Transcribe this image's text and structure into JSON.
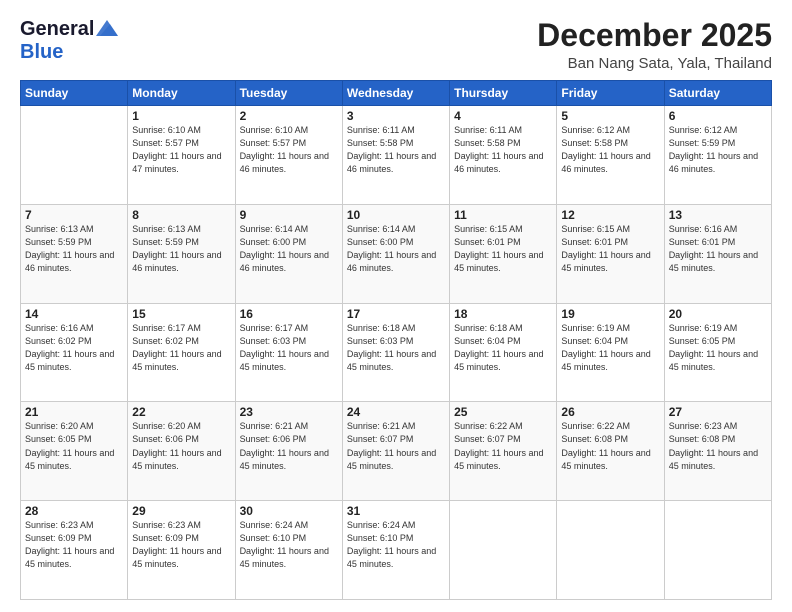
{
  "logo": {
    "general": "General",
    "blue": "Blue"
  },
  "header": {
    "month_title": "December 2025",
    "location": "Ban Nang Sata, Yala, Thailand"
  },
  "days_of_week": [
    "Sunday",
    "Monday",
    "Tuesday",
    "Wednesday",
    "Thursday",
    "Friday",
    "Saturday"
  ],
  "weeks": [
    [
      {
        "day": "",
        "info": ""
      },
      {
        "day": "1",
        "info": "Sunrise: 6:10 AM\nSunset: 5:57 PM\nDaylight: 11 hours\nand 47 minutes."
      },
      {
        "day": "2",
        "info": "Sunrise: 6:10 AM\nSunset: 5:57 PM\nDaylight: 11 hours\nand 46 minutes."
      },
      {
        "day": "3",
        "info": "Sunrise: 6:11 AM\nSunset: 5:58 PM\nDaylight: 11 hours\nand 46 minutes."
      },
      {
        "day": "4",
        "info": "Sunrise: 6:11 AM\nSunset: 5:58 PM\nDaylight: 11 hours\nand 46 minutes."
      },
      {
        "day": "5",
        "info": "Sunrise: 6:12 AM\nSunset: 5:58 PM\nDaylight: 11 hours\nand 46 minutes."
      },
      {
        "day": "6",
        "info": "Sunrise: 6:12 AM\nSunset: 5:59 PM\nDaylight: 11 hours\nand 46 minutes."
      }
    ],
    [
      {
        "day": "7",
        "info": "Sunrise: 6:13 AM\nSunset: 5:59 PM\nDaylight: 11 hours\nand 46 minutes."
      },
      {
        "day": "8",
        "info": "Sunrise: 6:13 AM\nSunset: 5:59 PM\nDaylight: 11 hours\nand 46 minutes."
      },
      {
        "day": "9",
        "info": "Sunrise: 6:14 AM\nSunset: 6:00 PM\nDaylight: 11 hours\nand 46 minutes."
      },
      {
        "day": "10",
        "info": "Sunrise: 6:14 AM\nSunset: 6:00 PM\nDaylight: 11 hours\nand 46 minutes."
      },
      {
        "day": "11",
        "info": "Sunrise: 6:15 AM\nSunset: 6:01 PM\nDaylight: 11 hours\nand 45 minutes."
      },
      {
        "day": "12",
        "info": "Sunrise: 6:15 AM\nSunset: 6:01 PM\nDaylight: 11 hours\nand 45 minutes."
      },
      {
        "day": "13",
        "info": "Sunrise: 6:16 AM\nSunset: 6:01 PM\nDaylight: 11 hours\nand 45 minutes."
      }
    ],
    [
      {
        "day": "14",
        "info": "Sunrise: 6:16 AM\nSunset: 6:02 PM\nDaylight: 11 hours\nand 45 minutes."
      },
      {
        "day": "15",
        "info": "Sunrise: 6:17 AM\nSunset: 6:02 PM\nDaylight: 11 hours\nand 45 minutes."
      },
      {
        "day": "16",
        "info": "Sunrise: 6:17 AM\nSunset: 6:03 PM\nDaylight: 11 hours\nand 45 minutes."
      },
      {
        "day": "17",
        "info": "Sunrise: 6:18 AM\nSunset: 6:03 PM\nDaylight: 11 hours\nand 45 minutes."
      },
      {
        "day": "18",
        "info": "Sunrise: 6:18 AM\nSunset: 6:04 PM\nDaylight: 11 hours\nand 45 minutes."
      },
      {
        "day": "19",
        "info": "Sunrise: 6:19 AM\nSunset: 6:04 PM\nDaylight: 11 hours\nand 45 minutes."
      },
      {
        "day": "20",
        "info": "Sunrise: 6:19 AM\nSunset: 6:05 PM\nDaylight: 11 hours\nand 45 minutes."
      }
    ],
    [
      {
        "day": "21",
        "info": "Sunrise: 6:20 AM\nSunset: 6:05 PM\nDaylight: 11 hours\nand 45 minutes."
      },
      {
        "day": "22",
        "info": "Sunrise: 6:20 AM\nSunset: 6:06 PM\nDaylight: 11 hours\nand 45 minutes."
      },
      {
        "day": "23",
        "info": "Sunrise: 6:21 AM\nSunset: 6:06 PM\nDaylight: 11 hours\nand 45 minutes."
      },
      {
        "day": "24",
        "info": "Sunrise: 6:21 AM\nSunset: 6:07 PM\nDaylight: 11 hours\nand 45 minutes."
      },
      {
        "day": "25",
        "info": "Sunrise: 6:22 AM\nSunset: 6:07 PM\nDaylight: 11 hours\nand 45 minutes."
      },
      {
        "day": "26",
        "info": "Sunrise: 6:22 AM\nSunset: 6:08 PM\nDaylight: 11 hours\nand 45 minutes."
      },
      {
        "day": "27",
        "info": "Sunrise: 6:23 AM\nSunset: 6:08 PM\nDaylight: 11 hours\nand 45 minutes."
      }
    ],
    [
      {
        "day": "28",
        "info": "Sunrise: 6:23 AM\nSunset: 6:09 PM\nDaylight: 11 hours\nand 45 minutes."
      },
      {
        "day": "29",
        "info": "Sunrise: 6:23 AM\nSunset: 6:09 PM\nDaylight: 11 hours\nand 45 minutes."
      },
      {
        "day": "30",
        "info": "Sunrise: 6:24 AM\nSunset: 6:10 PM\nDaylight: 11 hours\nand 45 minutes."
      },
      {
        "day": "31",
        "info": "Sunrise: 6:24 AM\nSunset: 6:10 PM\nDaylight: 11 hours\nand 45 minutes."
      },
      {
        "day": "",
        "info": ""
      },
      {
        "day": "",
        "info": ""
      },
      {
        "day": "",
        "info": ""
      }
    ]
  ]
}
